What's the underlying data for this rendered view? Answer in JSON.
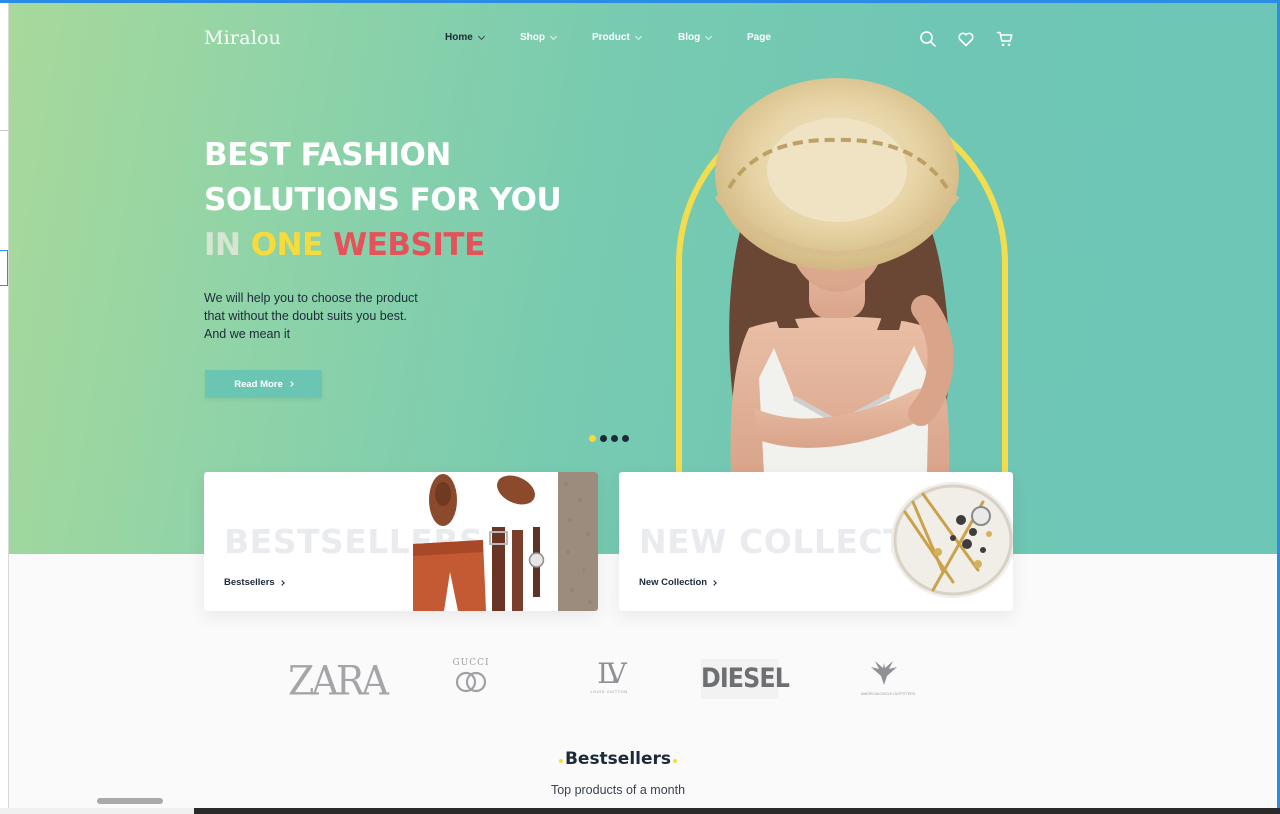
{
  "brand": {
    "logo": "Miralou"
  },
  "nav": {
    "items": [
      {
        "label": "Home",
        "active": true,
        "dropdown": true
      },
      {
        "label": "Shop",
        "active": false,
        "dropdown": true
      },
      {
        "label": "Product",
        "active": false,
        "dropdown": true
      },
      {
        "label": "Blog",
        "active": false,
        "dropdown": true
      },
      {
        "label": "Page",
        "active": false,
        "dropdown": false
      }
    ],
    "icons": [
      "search-icon",
      "heart-icon",
      "cart-icon"
    ]
  },
  "hero": {
    "headline_line1": "BEST FASHION",
    "headline_line2": "SOLUTIONS FOR YOU",
    "headline_line3_a": "IN",
    "headline_line3_b": "ONE",
    "headline_line3_c": "WEBSITE",
    "subtext_line1": "We will help you to choose the product",
    "subtext_line2": "that without the doubt suits you best.",
    "subtext_line3": "And we mean it",
    "cta_label": "Read More",
    "slides_total": 4,
    "slide_active": 1
  },
  "cards": [
    {
      "watermark": "BESTSELLERS",
      "link_label": "Bestsellers"
    },
    {
      "watermark": "NEW COLLECTION",
      "link_label": "New Collection"
    }
  ],
  "brands": {
    "zara": "ZARA",
    "gucci": "GUCCI",
    "lv_monogram": "LV",
    "lv_caption": "LOUIS VUITTON",
    "diesel": "DIESEL",
    "american_eagle_caption": "AMERICAN EAGLE OUTFITTERS"
  },
  "section": {
    "title": "Bestsellers",
    "subtitle": "Top products of a month"
  },
  "colors": {
    "accent_teal": "#6bc5b3",
    "accent_yellow": "#f6db3a",
    "accent_red": "#e4535a",
    "dark": "#1d2a3a"
  }
}
